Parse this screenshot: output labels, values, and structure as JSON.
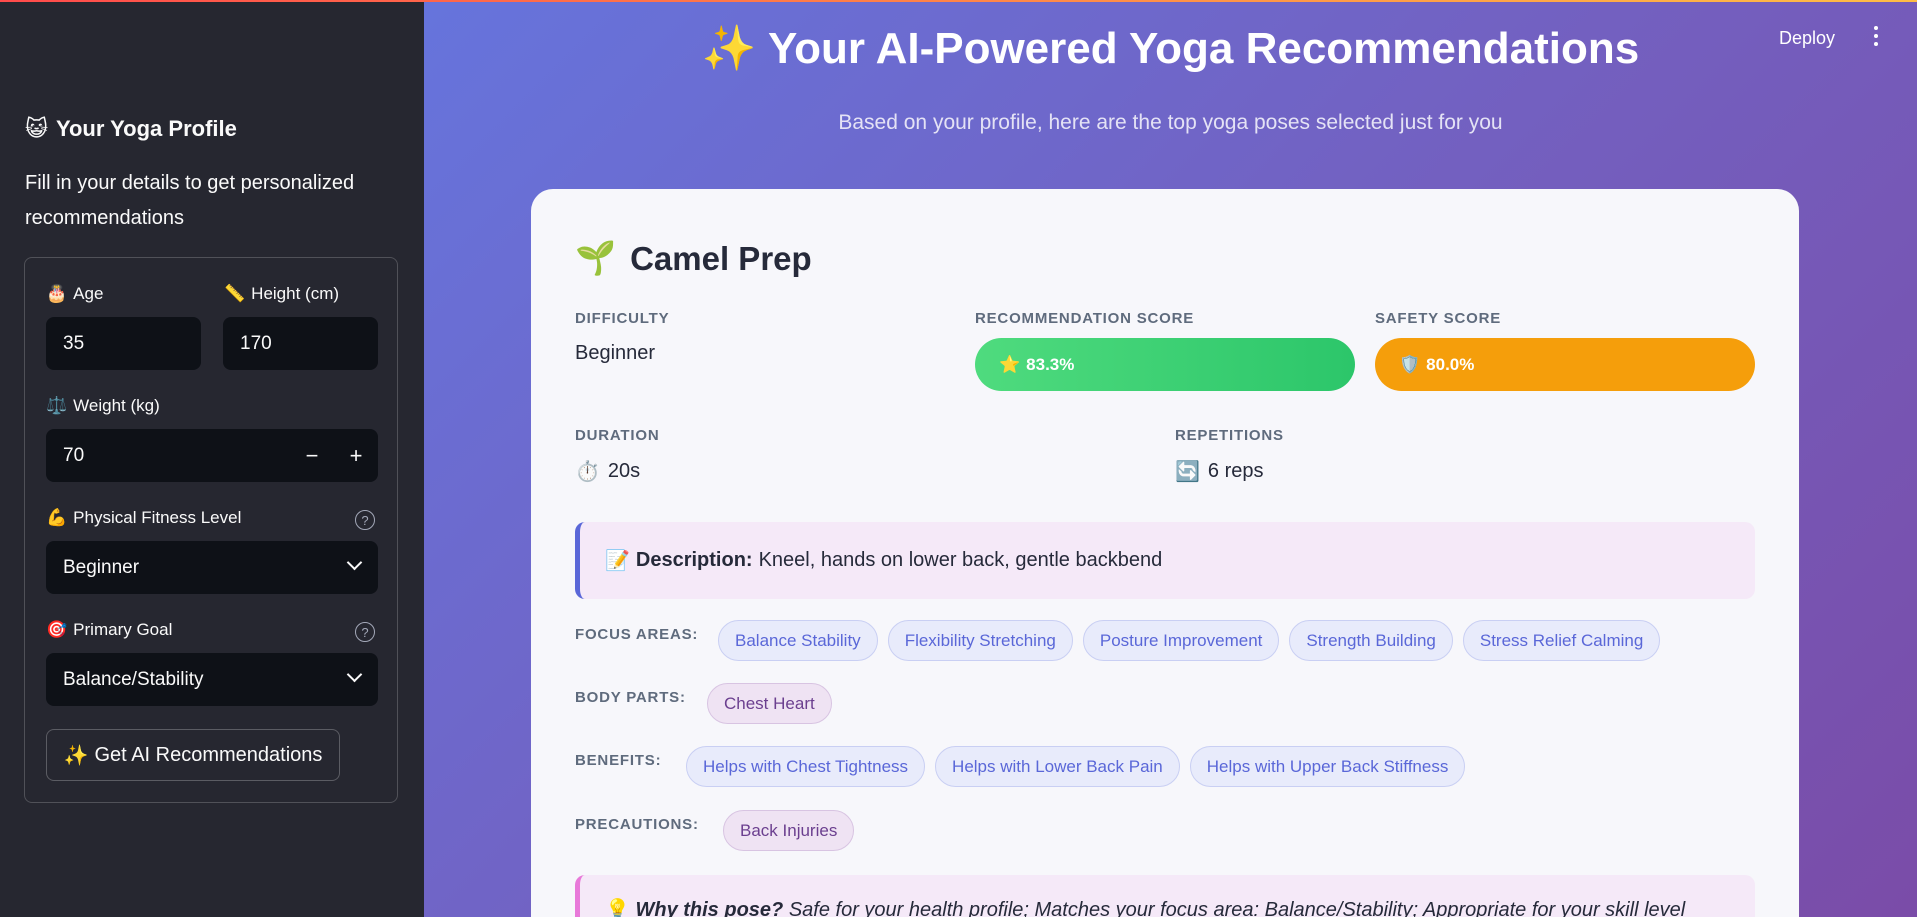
{
  "colors": {
    "accent": "#5a67d8",
    "recommendation_bar": "#2cc66a",
    "safety_bar": "#f59e0b",
    "sidebar_bg": "#262730",
    "input_bg": "#0e1117"
  },
  "header": {
    "deploy_label": "Deploy",
    "menu_icon": "kebab-menu-icon"
  },
  "sidebar": {
    "title_icon": "😺",
    "title": "Your Yoga Profile",
    "description": "Fill in your details to get personalized recommendations",
    "age": {
      "icon": "🎂",
      "label": "Age",
      "value": "35"
    },
    "height": {
      "icon": "📏",
      "label": "Height (cm)",
      "value": "170"
    },
    "weight": {
      "icon": "⚖️",
      "label": "Weight (kg)",
      "value": "70",
      "minus": "−",
      "plus": "+"
    },
    "fitness": {
      "icon": "💪",
      "label": "Physical Fitness Level",
      "value": "Beginner",
      "help": "?"
    },
    "goal": {
      "icon": "🎯",
      "label": "Primary Goal",
      "value": "Balance/Stability",
      "help": "?"
    },
    "button_icon": "✨",
    "button_label": "Get AI Recommendations"
  },
  "main": {
    "title_icon": "✨",
    "title": "Your AI-Powered Yoga Recommendations",
    "subtitle": "Based on your profile, here are the top yoga poses selected just for you",
    "pose": {
      "icon": "🌱",
      "name": "Camel Prep",
      "difficulty_label": "DIFFICULTY",
      "difficulty": "Beginner",
      "recommendation_label": "RECOMMENDATION SCORE",
      "recommendation_icon": "⭐",
      "recommendation_score": "83.3%",
      "safety_label": "SAFETY SCORE",
      "safety_icon": "🛡️",
      "safety_score": "80.0%",
      "duration_label": "DURATION",
      "duration_icon": "⏱️",
      "duration": "20s",
      "repetitions_label": "REPETITIONS",
      "repetitions_icon": "🔄",
      "repetitions": "6 reps",
      "description_icon": "📝",
      "description_label": "Description:",
      "description": "Kneel, hands on lower back, gentle backbend",
      "focus_label": "FOCUS AREAS:",
      "focus_areas": [
        "Balance Stability",
        "Flexibility Stretching",
        "Posture Improvement",
        "Strength Building",
        "Stress Relief Calming"
      ],
      "body_parts_label": "BODY PARTS:",
      "body_parts": [
        "Chest Heart"
      ],
      "benefits_label": "BENEFITS:",
      "benefits": [
        "Helps with Chest Tightness",
        "Helps with Lower Back Pain",
        "Helps with Upper Back Stiffness"
      ],
      "precautions_label": "PRECAUTIONS:",
      "precautions": [
        "Back Injuries"
      ],
      "why_icon": "💡",
      "why_label": "Why this pose?",
      "why_text": "Safe for your health profile; Matches your focus area: Balance/Stability; Appropriate for your skill level"
    }
  }
}
